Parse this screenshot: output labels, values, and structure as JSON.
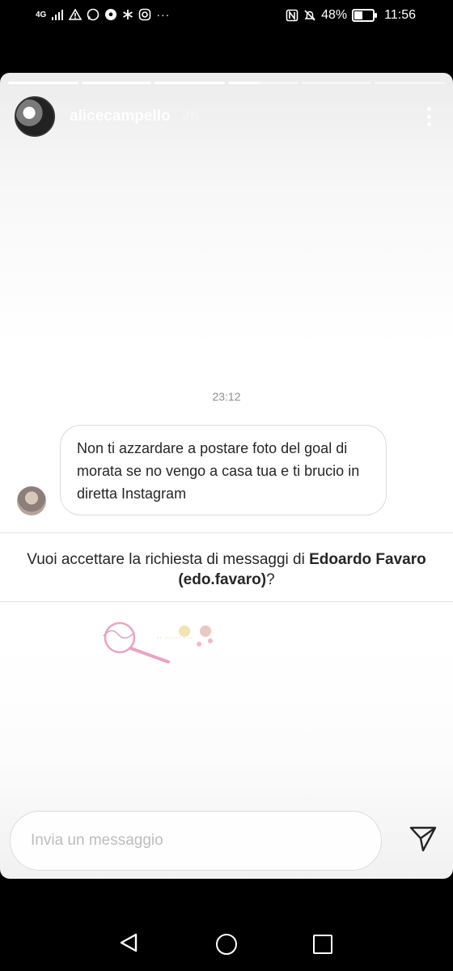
{
  "status_bar": {
    "network": "4G",
    "icons": [
      "signal-icon",
      "warning-icon",
      "whatsapp-icon",
      "soccer-ball-icon",
      "asterisk-icon",
      "instagram-icon",
      "more-icon"
    ],
    "right_icons": [
      "nfc-icon",
      "silent-icon"
    ],
    "battery_percent": "48%",
    "battery_level": 0.48,
    "time": "11:56"
  },
  "story": {
    "progress": [
      1,
      1,
      1,
      0.45,
      0,
      0
    ],
    "username": "alicecampello",
    "time_ago": "2h"
  },
  "chat": {
    "timestamp": "23:12",
    "message": "Non ti azzardare a postare foto del goal di morata se no vengo a casa tua e ti brucio in diretta Instagram"
  },
  "request": {
    "prefix": "Vuoi accettare la richiesta di messaggi di ",
    "name": "Edoardo Favaro (edo.favaro)",
    "suffix": "?"
  },
  "reply": {
    "placeholder": "Invia un messaggio"
  },
  "colors": {
    "text": "#262626",
    "muted": "#8e8e8e",
    "border": "#dbdbdb"
  }
}
